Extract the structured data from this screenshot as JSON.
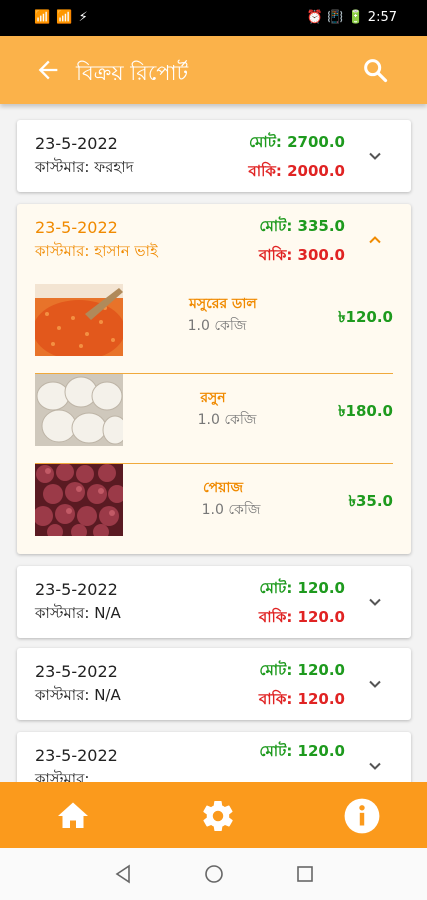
{
  "status_bar": {
    "signal": "📶 📶 ⚡",
    "right": "⏰ 📳 🔋 2:57"
  },
  "header": {
    "title": "বিক্রয় রিপোর্ট"
  },
  "reports": [
    {
      "date": "23-5-2022",
      "customer": "কাস্টমার:  ফরহাদ",
      "total": "মোট: 2700.0",
      "due": "বাকি: 2000.0",
      "expanded": false
    },
    {
      "date": "23-5-2022",
      "customer": "কাস্টমার:  হাসান ভাই",
      "total": "মোট: 335.0",
      "due": "বাকি: 300.0",
      "expanded": true,
      "items": [
        {
          "name": "মসুরের ডাল",
          "qty": "1.0 কেজি",
          "price": "৳120.0",
          "image": "red-lentils"
        },
        {
          "name": "রসুন",
          "qty": "1.0 কেজি",
          "price": "৳180.0",
          "image": "garlic"
        },
        {
          "name": "পেয়াজ",
          "qty": "1.0 কেজি",
          "price": "৳35.0",
          "image": "onions"
        }
      ]
    },
    {
      "date": "23-5-2022",
      "customer": "কাস্টমার:  N/A",
      "total": "মোট: 120.0",
      "due": "বাকি: 120.0",
      "expanded": false
    },
    {
      "date": "23-5-2022",
      "customer": "কাস্টমার:  N/A",
      "total": "মোট: 120.0",
      "due": "বাকি: 120.0",
      "expanded": false
    },
    {
      "date": "23-5-2022",
      "customer": "কাস্টমার:",
      "total": "মোট: 120.0",
      "due": "",
      "expanded": false
    }
  ],
  "icons": {
    "back": "arrow-left-icon",
    "search": "search-icon",
    "chevron_down": "chevron-down-icon",
    "chevron_up": "chevron-up-icon",
    "home": "home-icon",
    "settings": "gear-icon",
    "info": "info-icon"
  },
  "colors": {
    "primary": "#fbb24a",
    "nav": "#fb9a1c",
    "total": "#1e9a1e",
    "due": "#e02323",
    "accent": "#f08a00"
  }
}
